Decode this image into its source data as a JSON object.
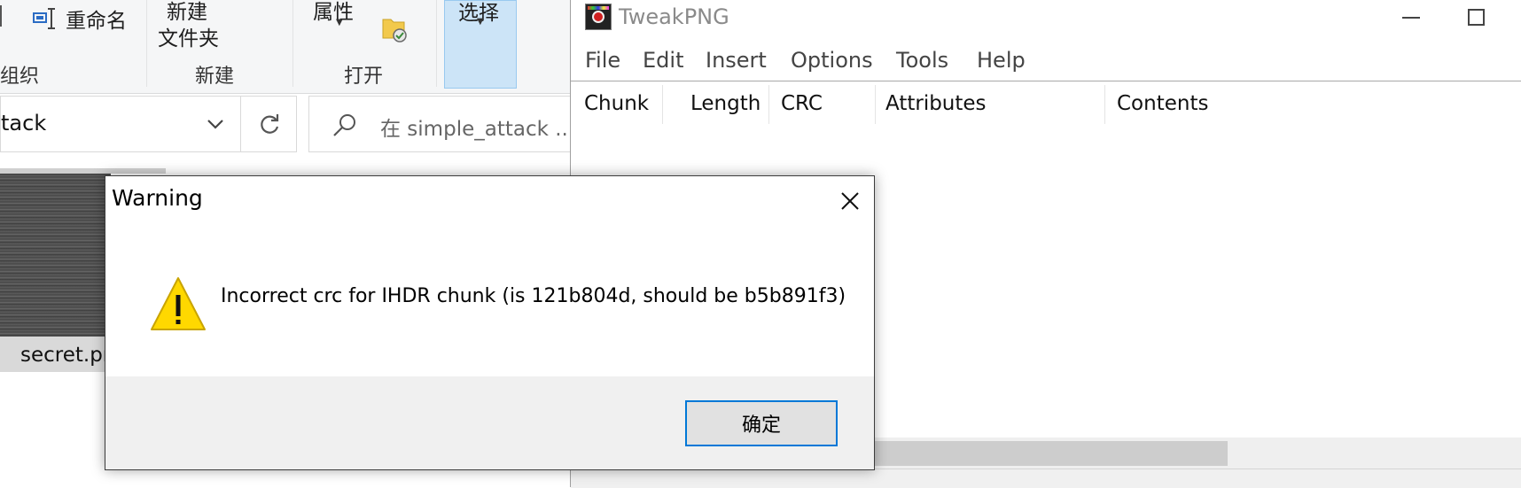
{
  "explorer": {
    "ribbon": {
      "rename_label": "重命名",
      "new_folder_label_line1": "新建",
      "new_folder_label_line2": "文件夹",
      "properties_label": "属性",
      "select_label": "选择",
      "group_organize": "组织",
      "group_new": "新建",
      "group_open": "打开"
    },
    "address": {
      "path_tail": "tack"
    },
    "search": {
      "placeholder": "在 simple_attack ..."
    },
    "file": {
      "name": "secret.pr"
    },
    "icons": {
      "refresh": "refresh-icon",
      "search": "search-icon",
      "chevron": "chevron-down-icon"
    }
  },
  "tweakpng": {
    "title": "TweakPNG",
    "menu": [
      "File",
      "Edit",
      "Insert",
      "Options",
      "Tools",
      "Help"
    ],
    "columns": [
      "Chunk",
      "Length",
      "CRC",
      "Attributes",
      "Contents"
    ],
    "rows": []
  },
  "dialog": {
    "title": "Warning",
    "message": "Incorrect crc for IHDR chunk (is 121b804d, should be b5b891f3)",
    "ok_label": "确定",
    "icon": "warning-icon"
  },
  "colors": {
    "accent": "#0078d7",
    "warning_fill": "#ffd800",
    "selected_ribbon": "#cce4f7"
  }
}
